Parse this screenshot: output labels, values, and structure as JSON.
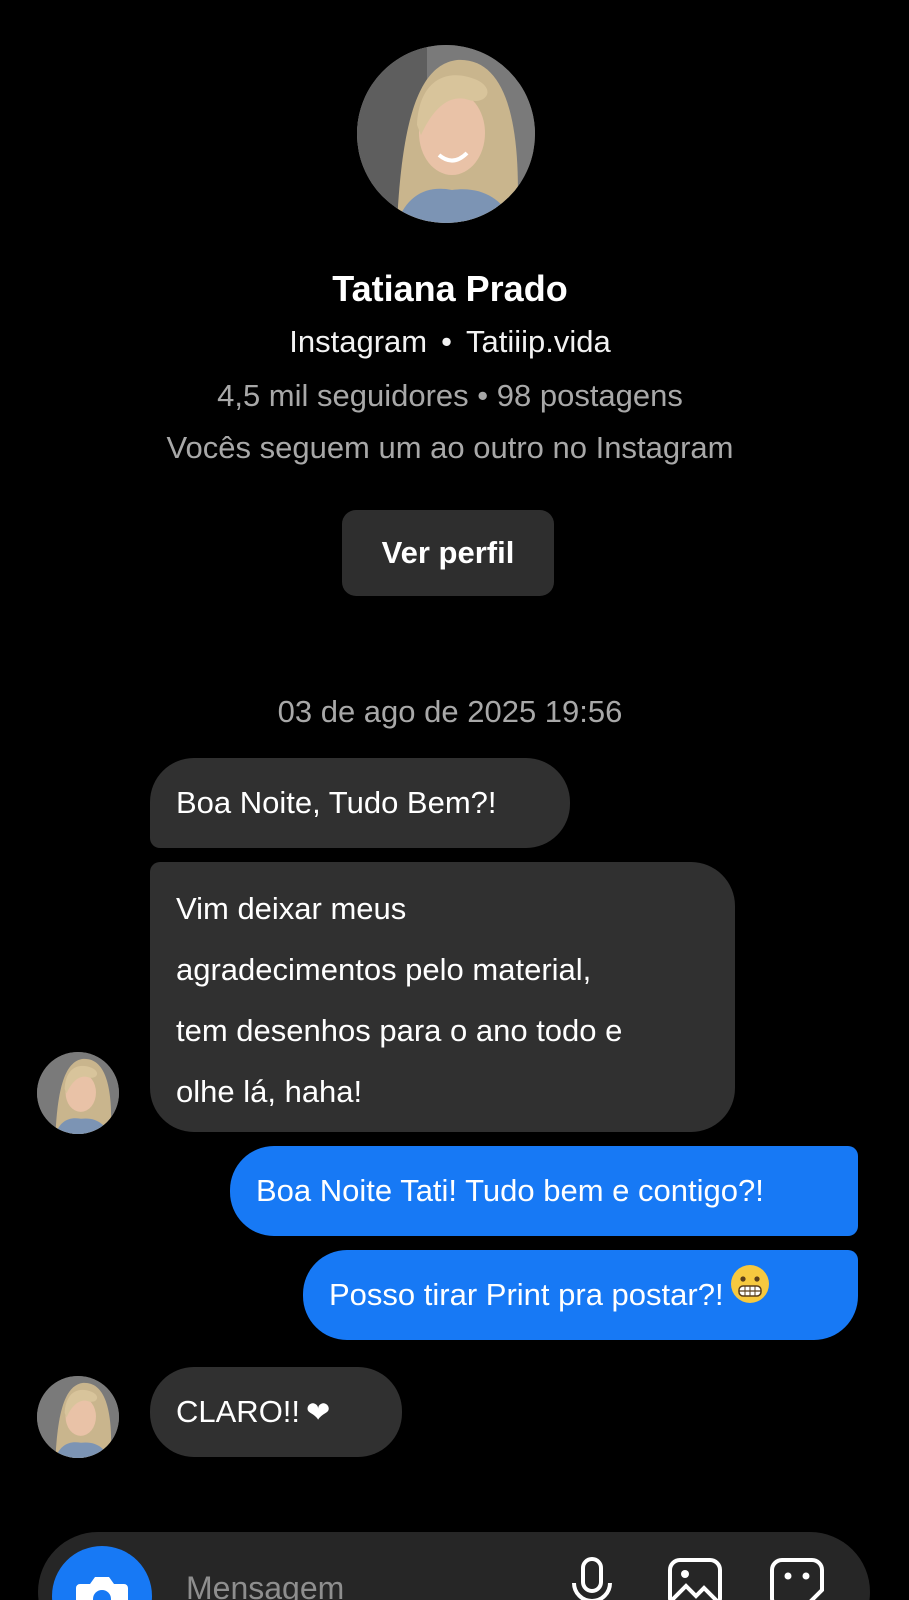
{
  "profile": {
    "name": "Tatiana Prado",
    "platform": "Instagram",
    "separator": "•",
    "username": "Tatiiip.vida",
    "stats": "4,5 mil seguidores • 98 postagens",
    "mutual": "Vocês seguem um ao outro no Instagram",
    "view_profile_label": "Ver perfil"
  },
  "conversation": {
    "timestamp": "03 de ago de 2025 19:56",
    "messages": [
      {
        "sender": "contact",
        "text": "Boa Noite, Tudo Bem?!"
      },
      {
        "sender": "contact",
        "lines": [
          "Vim deixar meus",
          "agradecimentos pelo material,",
          "tem desenhos para o ano todo e",
          "olhe lá, haha!"
        ]
      },
      {
        "sender": "me",
        "text": "Boa Noite Tati! Tudo bem e contigo?!"
      },
      {
        "sender": "me",
        "text": "Posso tirar Print pra postar?!",
        "emoji": "grimacing-face"
      },
      {
        "sender": "contact",
        "text": "CLARO!!",
        "emoji": "❤"
      }
    ]
  },
  "composer": {
    "placeholder": "Mensagem",
    "icons": [
      "camera-icon",
      "microphone-icon",
      "gallery-icon",
      "sticker-icon"
    ]
  },
  "colors": {
    "background": "#000000",
    "incoming_bubble": "#303030",
    "outgoing_bubble": "#1779f5",
    "secondary_text": "#a8a8a8",
    "button": "#2e2e2e"
  }
}
